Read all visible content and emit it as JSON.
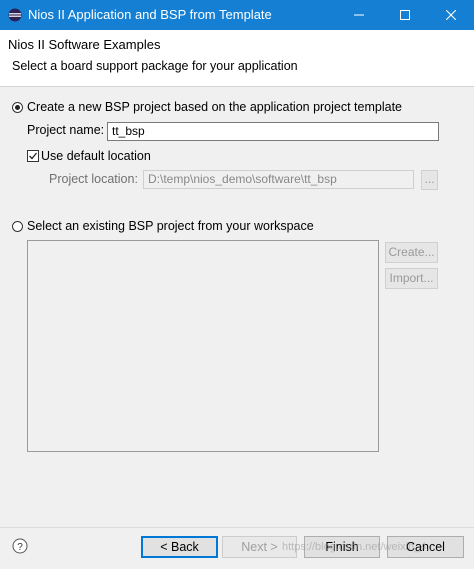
{
  "window": {
    "title": "Nios II Application and BSP from Template",
    "app_icon": "eclipse-icon",
    "controls": [
      "minimize-icon",
      "maximize-icon",
      "close-icon"
    ]
  },
  "header": {
    "title": "Nios II Software Examples",
    "subtitle": "Select a board support package for your application"
  },
  "create_new": {
    "radio_label": "Create a new BSP project based on the application project template",
    "selected": true,
    "project_name_label": "Project name:",
    "project_name_value": "tt_bsp",
    "use_default_label": "Use default location",
    "use_default_checked": true,
    "project_location_label": "Project location:",
    "project_location_value": "D:\\temp\\nios_demo\\software\\tt_bsp",
    "browse_label": "..."
  },
  "existing": {
    "radio_label": "Select an existing BSP project from your workspace",
    "selected": false,
    "create_label": "Create...",
    "import_label": "Import..."
  },
  "footer": {
    "help_icon": "help-icon",
    "back_label": "< Back",
    "next_label": "Next >",
    "finish_label": "Finish",
    "cancel_label": "Cancel"
  },
  "watermark": "https://blog.csdn.net/weixin_4..."
}
